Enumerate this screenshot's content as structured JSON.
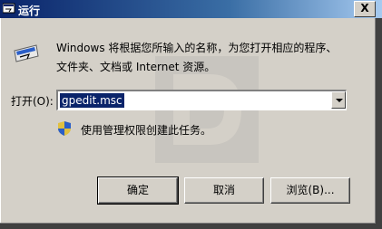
{
  "window": {
    "title": "运行",
    "close_label": "X"
  },
  "description": {
    "line1": "Windows 将根据您所输入的名称，为您打开相应的程序、",
    "line2": "文件夹、文档或 Internet 资源。"
  },
  "open": {
    "label": "打开(O):",
    "value": "gpedit.msc"
  },
  "admin_notice": "使用管理权限创建此任务。",
  "buttons": {
    "ok": "确定",
    "cancel": "取消",
    "browse": "浏览(B)..."
  },
  "icons": {
    "title": "run-icon",
    "main": "run-icon",
    "shield": "uac-shield-icon"
  },
  "colors": {
    "titlebar_start": "#0a246a",
    "titlebar_end": "#a6caf0",
    "face": "#d4d0c8",
    "selection": "#0a246a"
  }
}
